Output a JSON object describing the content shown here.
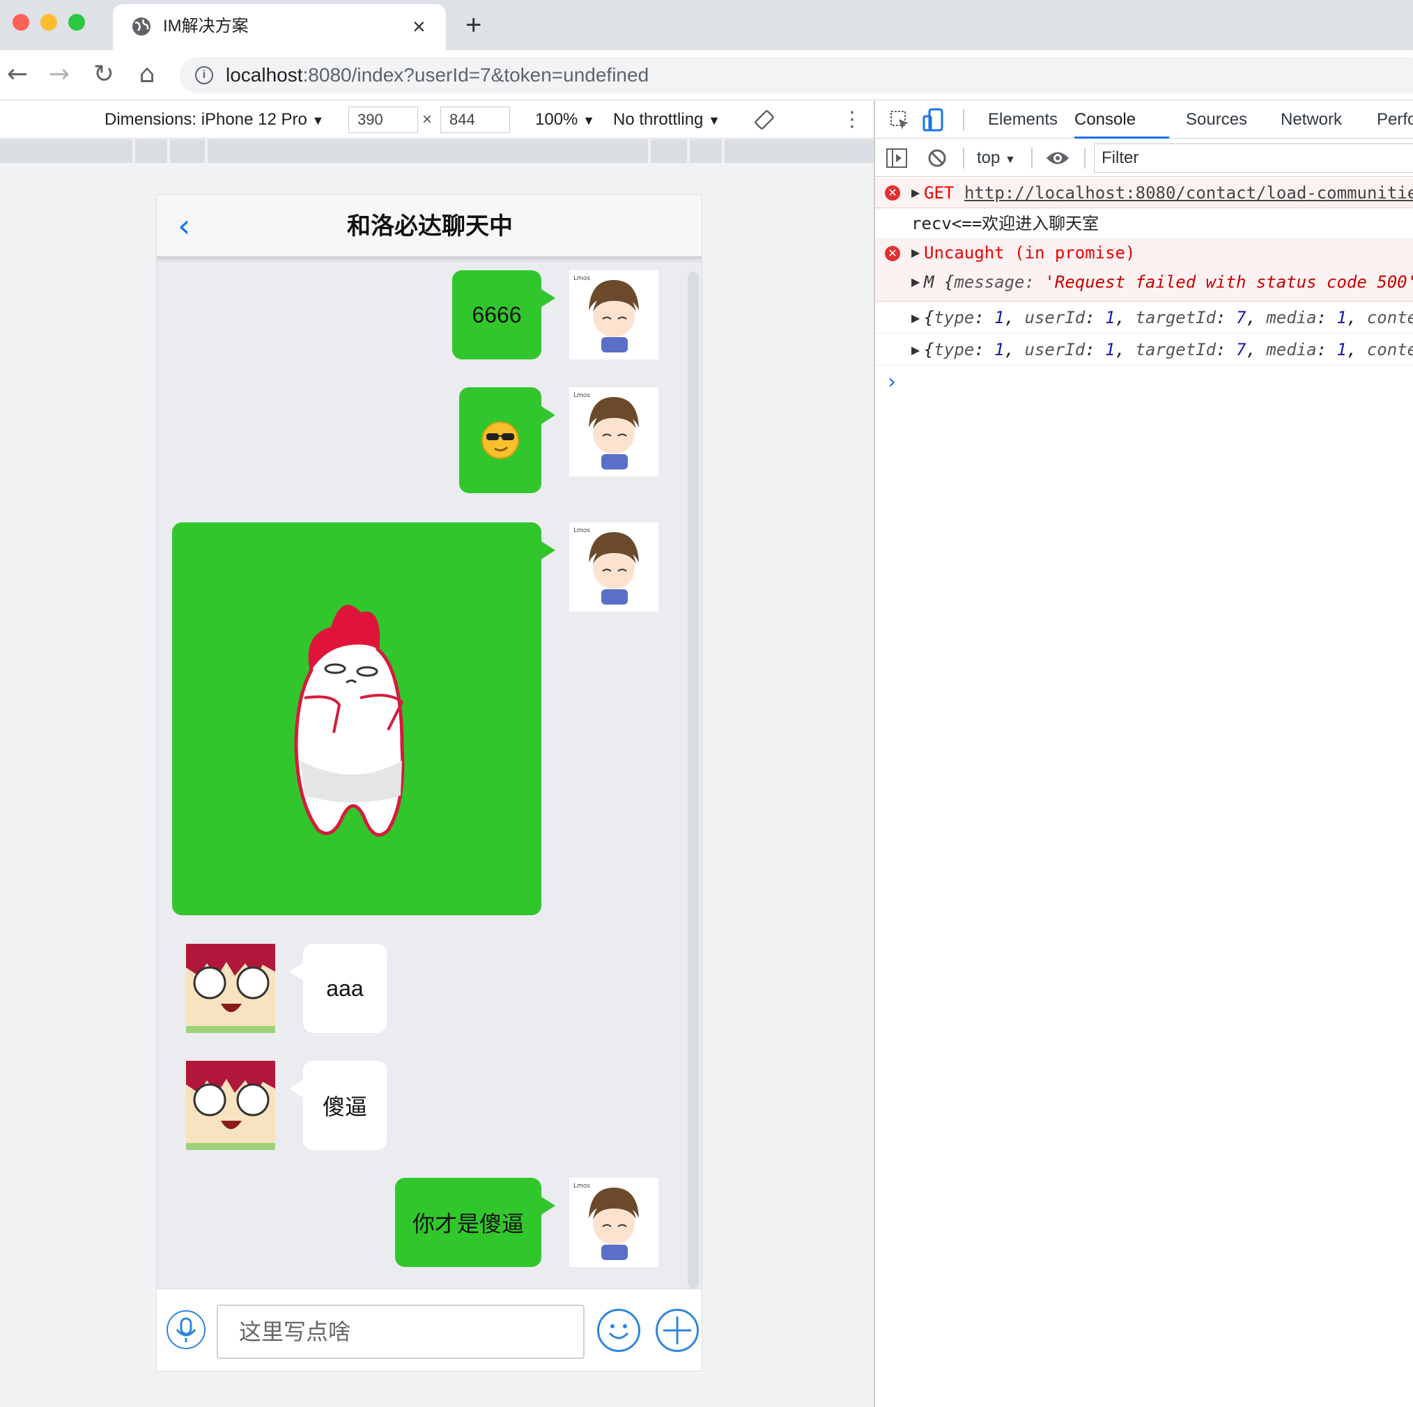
{
  "browser": {
    "tab_title": "IM解决方案",
    "new_tab": "+",
    "close_tab": "×",
    "url_host": "localhost",
    "url_rest": ":8080/index?userId=7&token=undefined"
  },
  "device_toolbar": {
    "dimensions_label": "Dimensions: iPhone 12 Pro",
    "width": "390",
    "times": "×",
    "height": "844",
    "zoom": "100%",
    "throttling": "No throttling"
  },
  "chat": {
    "title": "和洛必达聊天中",
    "back_glyph": "‹",
    "messages": [
      {
        "side": "right",
        "type": "text",
        "text": "6666"
      },
      {
        "side": "right",
        "type": "emoji",
        "text": "😎"
      },
      {
        "side": "right",
        "type": "sticker",
        "text": ""
      },
      {
        "side": "left",
        "type": "text",
        "text": "aaa"
      },
      {
        "side": "left",
        "type": "text",
        "text": "傻逼"
      },
      {
        "side": "right",
        "type": "text",
        "text": "你才是傻逼"
      }
    ],
    "input_placeholder": "这里写点啥"
  },
  "devtools": {
    "tabs": [
      "Elements",
      "Console",
      "Sources",
      "Network",
      "Perfo"
    ],
    "active_tab": "Console",
    "context": "top",
    "filter_placeholder": "Filter",
    "console": {
      "l1_method": "GET",
      "l1_url": "http://localhost:8080/contact/load-communitie",
      "l2": "recv<==欢迎进入聊天室",
      "l3": "Uncaught (in promise)",
      "l4_prefix": "M {",
      "l4_key": "message",
      "l4_value": "'Request failed with status code 500'",
      "l5": {
        "type": "1",
        "userId": "1",
        "targetId": "7",
        "media": "1",
        "tail": "conte"
      },
      "l6": {
        "type": "1",
        "userId": "1",
        "targetId": "7",
        "media": "1",
        "tail": "conte"
      },
      "prompt": "›"
    }
  },
  "colors": {
    "accent": "#1a73e8",
    "bubble_green": "#31c72c",
    "error_red": "#e03131"
  }
}
